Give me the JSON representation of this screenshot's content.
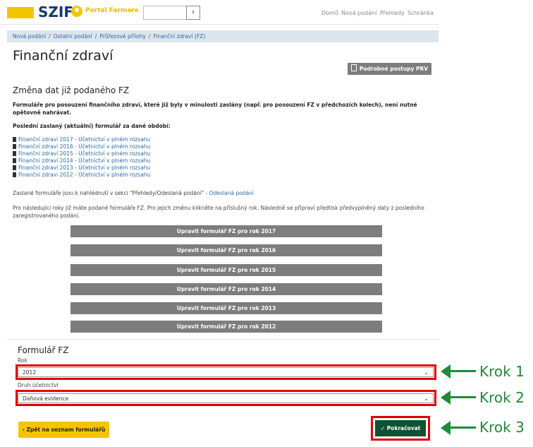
{
  "header": {
    "logo": "SZIF",
    "portal_name": "Portal Farmare",
    "nav": [
      "Domů",
      "Nová podání",
      "Přehledy",
      "Schránka"
    ]
  },
  "breadcrumb": [
    "Nová podání",
    "Ostatní podání",
    "Průřezové přílohy",
    "Finanční zdraví (FZ)"
  ],
  "page_title": "Finanční zdraví",
  "prv_button": "Podrobné postupy PRV",
  "section_title": "Změna dat již podaného FZ",
  "bold_note": "Formuláře pro posouzení finančního zdraví, které již byly v minulosti zaslány (např. pro posouzení FZ v předchozích kolech), není nutné opětovně nahrávat.",
  "last_sent_heading": "Poslední zaslaný (aktuální) formulář za dané období:",
  "links": [
    "Finanční zdraví 2017 - Účetnictví v plném rozsahu",
    "Finanční zdraví 2016 - Účetnictví v plném rozsahu",
    "Finanční zdraví 2015 - Účetnictví v plném rozsahu",
    "Finanční zdraví 2014 - Účetnictví v plném rozsahu",
    "Finanční zdraví 2013 - Účetnictví v plném rozsahu",
    "Finanční zdraví 2012 - Účetnictví v plném rozsahu"
  ],
  "sent_info": {
    "text": "Zaslané formuláře jsou k nahlédnutí v sekci \"Přehledy/Odeslaná podání\" - ",
    "link": "Odeslaná podání"
  },
  "info_paragraph": "Pro následující roky již máte podané formuláře FZ. Pro jejich změnu klikněte na příslušný rok. Následně se připraví předtisk předvyplněný daty z posledního zaregistrovaného podání.",
  "edit_buttons": [
    "Upravit formulář FZ pro rok 2017",
    "Upravit formulář FZ pro rok 2016",
    "Upravit formulář FZ pro rok 2015",
    "Upravit formulář FZ pro rok 2014",
    "Upravit formulář FZ pro rok 2013",
    "Upravit formulář FZ pro rok 2012"
  ],
  "form": {
    "title": "Formulář FZ",
    "year_label": "Rok",
    "year_value": "2012",
    "type_label": "Druh účetnictví",
    "type_value": "Daňová evidence"
  },
  "back_button": "Zpět na seznam formulářů",
  "continue_button": "Pokračovat",
  "annotations": [
    "Krok 1",
    "Krok 2",
    "Krok 3"
  ],
  "colors": {
    "accent": "#f5c400",
    "brand": "#163a6b",
    "highlight": "#e00000",
    "annotation": "#1f8a3a",
    "continue": "#0d5232"
  }
}
